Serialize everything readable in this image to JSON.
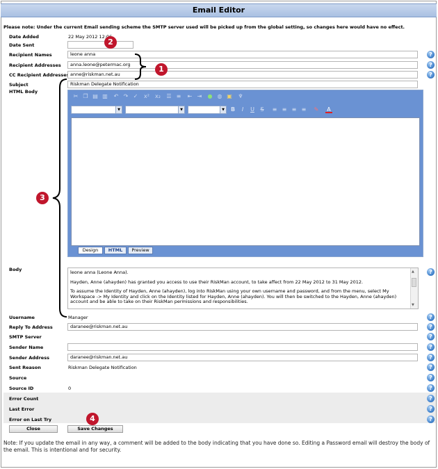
{
  "title": "Email Editor",
  "notice": "Please note: Under the current Email sending scheme the SMTP server used will be picked up from the global setting, so changes here would have no effect.",
  "fields": {
    "date_added": {
      "label": "Date Added",
      "value": "22 May 2012 12:06"
    },
    "date_sent": {
      "label": "Date Sent",
      "value": ""
    },
    "recipient_names": {
      "label": "Recipient Names",
      "value": "leone anna"
    },
    "recipient_addresses": {
      "label": "Recipient Addresses",
      "value": "anna.leone@petermac.org"
    },
    "cc_recipient_addresses": {
      "label": "CC Recipient Addresses",
      "value": "anne@riskman.net.au"
    },
    "subject": {
      "label": "Subject",
      "value": "Riskman Delegate Notification"
    },
    "html_body": {
      "label": "HTML Body"
    },
    "body": {
      "label": "Body"
    },
    "username": {
      "label": "Username",
      "value": "Manager"
    },
    "reply_to": {
      "label": "Reply To Address",
      "value": "daranee@riskman.net.au"
    },
    "smtp_server": {
      "label": "SMTP Server",
      "value": ""
    },
    "sender_name": {
      "label": "Sender Name",
      "value": ""
    },
    "sender_address": {
      "label": "Sender Address",
      "value": "daranee@riskman.net.au"
    },
    "sent_reason": {
      "label": "Sent Reason",
      "value": "Riskman Delegate Notification"
    },
    "source": {
      "label": "Source",
      "value": ""
    },
    "source_id": {
      "label": "Source ID",
      "value": "0"
    },
    "error_count": {
      "label": "Error Count",
      "value": ""
    },
    "last_error": {
      "label": "Last Error",
      "value": ""
    },
    "error_last_try": {
      "label": "Error on Last Try",
      "value": ""
    }
  },
  "body_text": [
    "leone anna (Leone Anna).",
    "Hayden, Anne (ahayden) has granted you access to use their RiskMan account, to take affect from 22 May 2012 to 31 May 2012.",
    "To assume the Identity of Hayden, Anne (ahayden), log into RiskMan using your own username and password, and from the menu, select My Workspace -> My Identity and click on the Identity listed for Hayden, Anne (ahayden). You will then be switched to the Hayden, Anne (ahayden) account and be able to take on their RiskMan permissions and responsibilities."
  ],
  "editor_tabs": [
    "Design",
    "HTML",
    "Preview"
  ],
  "active_tab": "Design",
  "toolbar_icons": [
    "cut-icon",
    "copy-icon",
    "paste-icon",
    "paste-text-icon",
    "undo-icon",
    "redo-icon",
    "spellcheck-icon",
    "superscript-icon",
    "subscript-icon",
    "ordered-list-icon",
    "unordered-list-icon",
    "outdent-icon",
    "indent-icon",
    "link-icon",
    "unlink-icon",
    "image-icon",
    "clean-icon"
  ],
  "format_icons": [
    "bold-icon",
    "italic-icon",
    "underline-icon",
    "strike-icon",
    "align-left-icon",
    "align-center-icon",
    "align-right-icon",
    "justify-icon",
    "highlight-icon",
    "font-color-icon"
  ],
  "buttons": {
    "close": "Close",
    "save": "Save Changes"
  },
  "help_glyph": "?",
  "callouts": [
    "1",
    "2",
    "3",
    "4"
  ],
  "footer": "Note: If you update the email in any way, a comment will be added to the body indicating that you have done so.  Editing a Password email will destroy the body of the email. This is intentional and for security.",
  "colors": {
    "title_bar": "#b8cbe8",
    "toolbar": "#6a92d3",
    "callout": "#c0162c",
    "help": "#3b7dc9"
  }
}
